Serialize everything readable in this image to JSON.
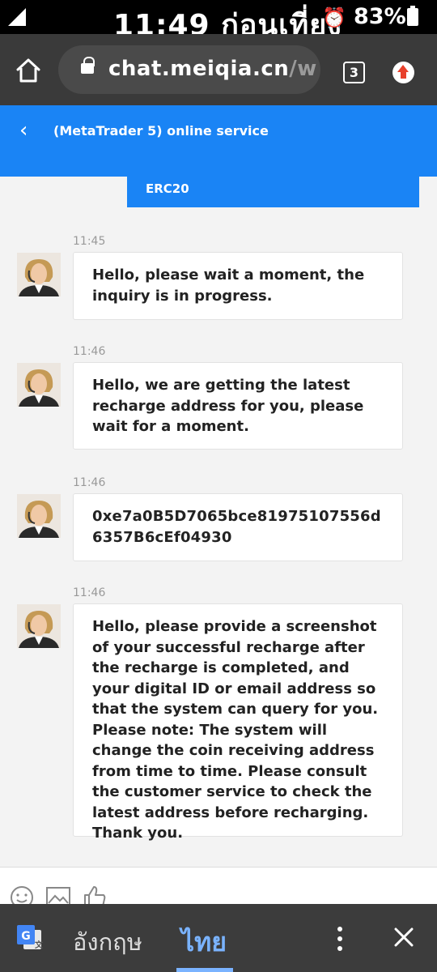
{
  "status_bar": {
    "time": "11:49 ก่อนเที่ยง",
    "battery": "83%"
  },
  "browser": {
    "url_main": "chat.meiqia.cn",
    "url_rest": "/w",
    "tab_count": "3"
  },
  "chat_header": {
    "back_icon": "‹",
    "title": "(MetaTrader 5) online service"
  },
  "pinned_card": {
    "label": "ERC20"
  },
  "messages": [
    {
      "time": "11:45",
      "text": "Hello, please wait a moment, the inquiry is in progress."
    },
    {
      "time": "11:46",
      "text": "Hello, we are getting the latest recharge address for you, please wait for a moment."
    },
    {
      "time": "11:46",
      "text": "0xe7a0B5D7065bce81975107556d6357B6cEf04930"
    },
    {
      "time": "11:46",
      "text": "Hello, please provide a screenshot of your successful recharge after the recharge is completed, and your digital ID or email address so that the system can query for you. Please note: The system will change the coin receiving address from time to time. Please consult the customer service to check the latest address before recharging. Thank you."
    }
  ],
  "toolbar": {
    "icons": [
      "emoji-icon",
      "image-icon",
      "thumbs-up-icon"
    ]
  },
  "translate_bar": {
    "source_lang": "อังกฤษ",
    "target_lang": "ไทย"
  },
  "colors": {
    "accent_blue": "#1a84f5",
    "status_bar_bg": "#000000",
    "browser_bg": "#3a3a3a",
    "translate_active": "#7ab3ff"
  }
}
